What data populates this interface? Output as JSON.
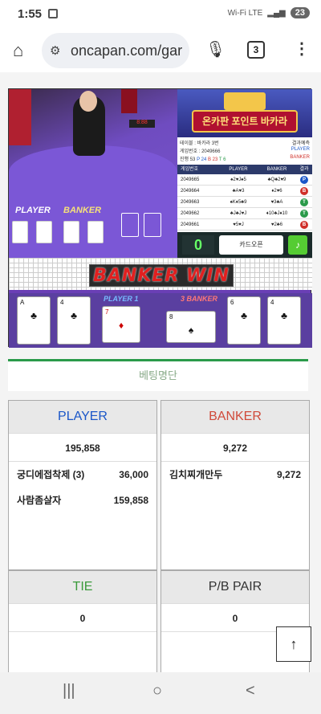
{
  "status": {
    "time": "1:55",
    "battery": "23",
    "network": "Wi-Fi LTE"
  },
  "browser": {
    "url": "oncapan.com/gar",
    "tabs_count": "3"
  },
  "game": {
    "video": {
      "player_label": "PLAYER",
      "banker_label": "BANKER",
      "led": "8:88"
    },
    "logo_text": "온카판 포인트 바카라",
    "info": {
      "table": "테이블 : 바카라 3번",
      "game_no": "게임번호 : 2049666",
      "progress": "진행 53",
      "p_count": "P 24",
      "b_count": "B 23",
      "t_count": "T 6",
      "predict": "결과예측",
      "player": "PLAYER",
      "banker": "BANKER"
    },
    "history": {
      "headers": [
        "게임번호",
        "PLAYER",
        "BANKER",
        "결과"
      ],
      "rows": [
        {
          "no": "2049665",
          "player": "♠2♥J♠5",
          "banker": "♣Q♣2♥9",
          "result": "P",
          "color": "#1a56c8"
        },
        {
          "no": "2049664",
          "player": "♣A♥3",
          "banker": "♦2♥6",
          "result": "B",
          "color": "#d0302a"
        },
        {
          "no": "2049663",
          "player": "♠K♦5♣9",
          "banker": "♥3♣A",
          "result": "T",
          "color": "#2a9a4a"
        },
        {
          "no": "2049662",
          "player": "♣J♣J♥J",
          "banker": "♦10♣J♦10",
          "result": "T",
          "color": "#2a9a4a"
        },
        {
          "no": "2049661",
          "player": "♥5♥J",
          "banker": "♥2♣6",
          "result": "B",
          "color": "#d0302a"
        }
      ]
    },
    "controls": {
      "count": "0",
      "open_label": "카드오픈",
      "sound_icon": "♪"
    },
    "win_banner": "BANKER WIN",
    "player_score": "PLAYER 1",
    "banker_score": "3 BANKER",
    "cards": [
      {
        "rank": "A",
        "suit": "♣",
        "red": false
      },
      {
        "rank": "4",
        "suit": "♣",
        "red": false
      },
      {
        "rank": "7",
        "suit": "♦",
        "red": true
      },
      {
        "rank": "8",
        "suit": "♠",
        "red": false
      },
      {
        "rank": "6",
        "suit": "♣",
        "red": false
      },
      {
        "rank": "4",
        "suit": "♣",
        "red": false
      }
    ]
  },
  "betting": {
    "title": "베팅명단",
    "player": {
      "label": "PLAYER",
      "total": "195,858",
      "entries": [
        {
          "name": "궁디에접착제 (3)",
          "amount": "36,000"
        },
        {
          "name": "사람좀살자",
          "amount": "159,858"
        }
      ],
      "color": "#1a56c8"
    },
    "banker": {
      "label": "BANKER",
      "total": "9,272",
      "entries": [
        {
          "name": "김치찌개만두",
          "amount": "9,272"
        }
      ],
      "color": "#d04a3a"
    },
    "tie": {
      "label": "TIE",
      "total": "0",
      "color": "#3a9a3a"
    },
    "pair": {
      "label": "P/B PAIR",
      "total": "0",
      "color": "#333333"
    }
  },
  "scroll_top_icon": "↑",
  "nav": {
    "recent": "|||",
    "home": "○",
    "back": "<"
  }
}
